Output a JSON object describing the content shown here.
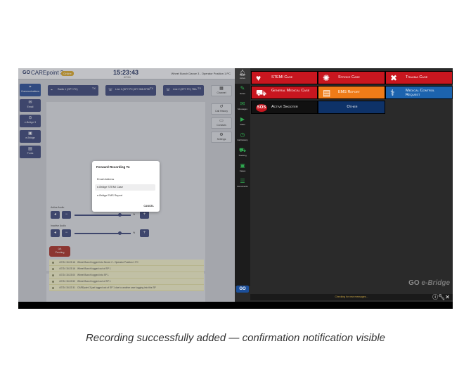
{
  "left_app": {
    "logo": "GO",
    "name": "CAREpoint 3",
    "status": "Online",
    "clock": "15:23:43",
    "date": "6/7/24",
    "user": "Wheel Bunch Dance 3 - Operator Position 1 PC",
    "nav": [
      {
        "label": "Communications",
        "icon": "radio-icon"
      },
      {
        "label": "Email",
        "icon": "mail-icon"
      },
      {
        "label": "e-Bridge 3",
        "icon": "bridge-icon"
      },
      {
        "label": "e-Bridge",
        "icon": "bridge-icon"
      },
      {
        "label": "Fonts",
        "icon": "doc-icon"
      }
    ],
    "radios": [
      {
        "label": "Radio 1 (GPY PC)",
        "tx": "TX"
      },
      {
        "label": "Line 1 (GPY PC) 877-968-5798",
        "tx": "TX"
      },
      {
        "label": "Line 2 (GPY PC) TBA",
        "tx": "TX"
      }
    ],
    "right_nav": [
      {
        "label": "Channel",
        "icon": "grid-icon"
      },
      {
        "label": "Call History",
        "icon": "phone-icon"
      },
      {
        "label": "Contacts",
        "icon": "contacts-icon"
      },
      {
        "label": "Settings",
        "icon": "gear-icon"
      }
    ],
    "audio": {
      "active_label": "Active Audio",
      "inactive_label": "Inactive Audio",
      "active_level": 0.8,
      "inactive_level": 0.8,
      "pct_label": "%"
    },
    "pending": {
      "count": "0/4",
      "label": "Pending"
    },
    "log": [
      {
        "time": "4/7/24 15:23:16",
        "msg": "Wheel Bunch logged into Server 2 - Operator Position 1 PC"
      },
      {
        "time": "4/7/24 15:23:16",
        "msg": "Wheel Bunch logged out of SP 1"
      },
      {
        "time": "4/7/24 15:23:00",
        "msg": "Wheel Bunch logged into SP 1"
      },
      {
        "time": "4/7/24 15:22:52",
        "msg": "Wheel Bunch logged out of SP 1"
      },
      {
        "time": "4/7/24 15:22:31",
        "msg": "CAREpoint 3 just logged out of SP 1 due to another user logging into this SP"
      }
    ]
  },
  "modal": {
    "title": "Forward Recording To",
    "options": [
      "Email Address",
      "e-Bridge STEMI Case",
      "e-Bridge EMS Report"
    ],
    "cancel": "CANCEL"
  },
  "right_app": {
    "sidebar": [
      {
        "label": "Active",
        "icon": "bell-icon"
      },
      {
        "label": "Notes",
        "icon": "notes-icon"
      },
      {
        "label": "Messages",
        "icon": "mail-icon"
      },
      {
        "label": "Video",
        "icon": "video-icon"
      },
      {
        "label": "Call History",
        "icon": "clock-icon"
      },
      {
        "label": "Tracking",
        "icon": "ambulance-icon"
      },
      {
        "label": "Cases",
        "icon": "cases-icon"
      },
      {
        "label": "Documents",
        "icon": "list-icon"
      }
    ],
    "cases": [
      {
        "label": "STEMI Case",
        "icon": "heart-icon",
        "color": "#c8161f"
      },
      {
        "label": "Stroke Case",
        "icon": "brain-icon",
        "color": "#c8161f"
      },
      {
        "label": "Trauma Case",
        "icon": "bandage-icon",
        "color": "#c8161f"
      },
      {
        "label": "General Medical Case",
        "icon": "ambulance-icon",
        "color": "#c8161f"
      },
      {
        "label": "EMS Report",
        "icon": "report-icon",
        "color": "#ee7b18"
      },
      {
        "label": "Medical Control Request",
        "icon": "stethoscope-icon",
        "color": "#1c63ae"
      },
      {
        "label": "Active Shooter",
        "icon": "sos-icon",
        "color": "#111111"
      },
      {
        "label": "Other",
        "icon": "",
        "color": "#0e3268"
      }
    ],
    "brand": "e-Bridge",
    "brand_go": "GO",
    "status": "Checking for new messages..."
  },
  "caption": "Recording successfully added — confirmation notification visible"
}
